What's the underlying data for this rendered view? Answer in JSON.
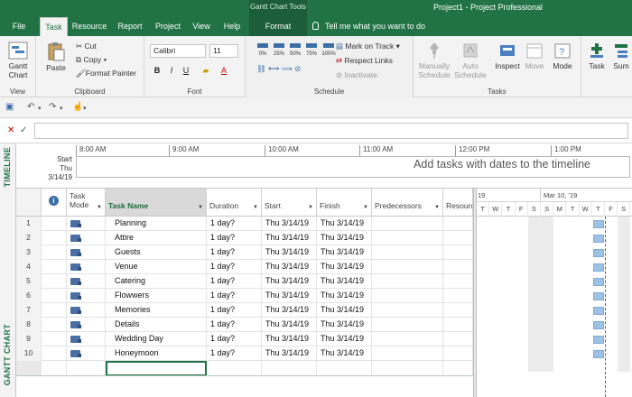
{
  "titlebar": {
    "context_group": "Gantt Chart Tools",
    "app_title": "Project1  -  Project Professional",
    "tabs": [
      "File",
      "Task",
      "Resource",
      "Report",
      "Project",
      "View",
      "Help",
      "Format"
    ],
    "tell_me": "Tell me what you want to do"
  },
  "ribbon": {
    "view_group": {
      "gantt_chart": "Gantt Chart",
      "label": "View"
    },
    "clipboard": {
      "paste": "Paste",
      "cut": "Cut",
      "copy": "Copy",
      "format_painter": "Format Painter",
      "label": "Clipboard"
    },
    "font": {
      "family": "Calibri",
      "size": "11",
      "bold": "B",
      "italic": "I",
      "underline": "U",
      "label": "Font"
    },
    "schedule": {
      "mark_on_track": "Mark on Track",
      "respect_links": "Respect Links",
      "inactivate": "Inactivate",
      "label": "Schedule",
      "pct": [
        "0%",
        "25%",
        "50%",
        "75%",
        "100%"
      ]
    },
    "tasks": {
      "manually": "Manually Schedule",
      "auto": "Auto Schedule",
      "inspect": "Inspect",
      "move": "Move",
      "mode": "Mode",
      "label": "Tasks"
    },
    "insert": {
      "task": "Task",
      "summary": "Sum"
    }
  },
  "timeline": {
    "side_label": "TIMELINE",
    "start_label": "Start",
    "start_date": "Thu 3/14/19",
    "ticks": [
      "8:00 AM",
      "9:00 AM",
      "10:00 AM",
      "11:00 AM",
      "12:00 PM",
      "1:00 PM"
    ],
    "message": "Add tasks with dates to the timeline"
  },
  "grid": {
    "side_label": "GANTT CHART",
    "headers": {
      "mode": "Task Mode",
      "name": "Task Name",
      "duration": "Duration",
      "start": "Start",
      "finish": "Finish",
      "predecessors": "Predecessors",
      "resource": "Resourc"
    },
    "rows": [
      {
        "id": "1",
        "name": "Planning",
        "duration": "1 day?",
        "start": "Thu 3/14/19",
        "finish": "Thu 3/14/19"
      },
      {
        "id": "2",
        "name": "Attire",
        "duration": "1 day?",
        "start": "Thu 3/14/19",
        "finish": "Thu 3/14/19"
      },
      {
        "id": "3",
        "name": "Guests",
        "duration": "1 day?",
        "start": "Thu 3/14/19",
        "finish": "Thu 3/14/19"
      },
      {
        "id": "4",
        "name": "Venue",
        "duration": "1 day?",
        "start": "Thu 3/14/19",
        "finish": "Thu 3/14/19"
      },
      {
        "id": "5",
        "name": "Catering",
        "duration": "1 day?",
        "start": "Thu 3/14/19",
        "finish": "Thu 3/14/19"
      },
      {
        "id": "6",
        "name": "Flowwers",
        "duration": "1 day?",
        "start": "Thu 3/14/19",
        "finish": "Thu 3/14/19"
      },
      {
        "id": "7",
        "name": "Memories",
        "duration": "1 day?",
        "start": "Thu 3/14/19",
        "finish": "Thu 3/14/19"
      },
      {
        "id": "8",
        "name": "Details",
        "duration": "1 day?",
        "start": "Thu 3/14/19",
        "finish": "Thu 3/14/19"
      },
      {
        "id": "9",
        "name": "Wedding Day",
        "duration": "1 day?",
        "start": "Thu 3/14/19",
        "finish": "Thu 3/14/19"
      },
      {
        "id": "10",
        "name": "Honeymoon",
        "duration": "1 day?",
        "start": "Thu 3/14/19",
        "finish": "Thu 3/14/19"
      }
    ]
  },
  "chart": {
    "prev_week": "19",
    "week_label": "Mar 10, '19",
    "days": [
      "T",
      "W",
      "T",
      "F",
      "S",
      "S",
      "M",
      "T",
      "W",
      "T",
      "F",
      "S"
    ]
  }
}
